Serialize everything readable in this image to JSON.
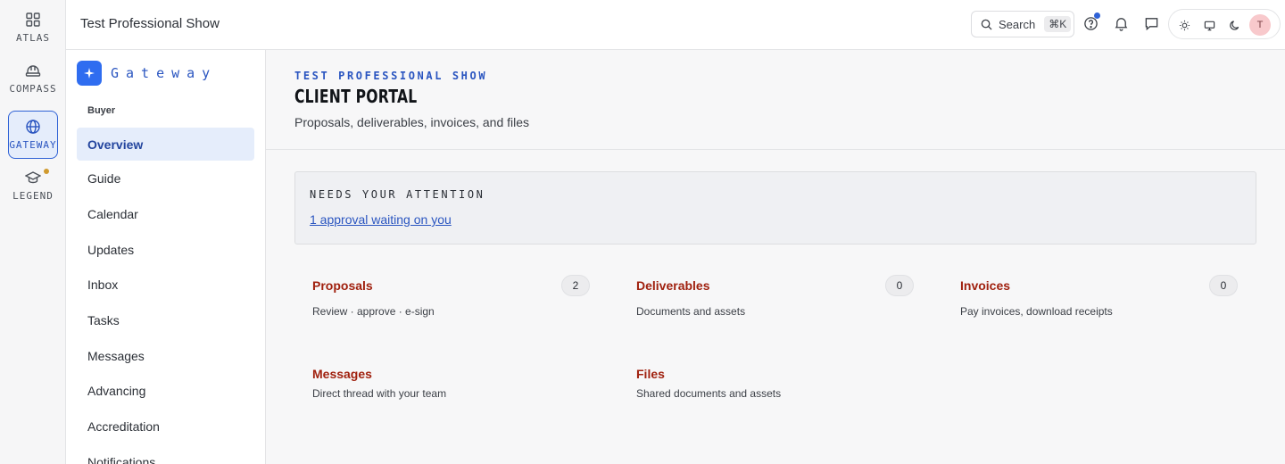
{
  "rail": {
    "items": [
      {
        "label": "ATLAS",
        "icon": "grid-icon"
      },
      {
        "label": "COMPASS",
        "icon": "hard-hat-icon"
      },
      {
        "label": "GATEWAY",
        "icon": "globe-icon",
        "active": true
      },
      {
        "label": "LEGEND",
        "icon": "graduation-cap-icon",
        "has_dot": true
      }
    ]
  },
  "topbar": {
    "title": "Test Professional Show",
    "search_label": "Search",
    "search_shortcut": "⌘K",
    "icons": [
      "help-icon",
      "bell-icon",
      "chat-icon"
    ],
    "theme_options": [
      "sun-icon",
      "monitor-icon",
      "moon-icon"
    ],
    "avatar_initial": "T"
  },
  "sidebar": {
    "brand": "Gateway",
    "section": "Buyer",
    "items": [
      {
        "label": "Overview",
        "active": true
      },
      {
        "label": "Guide"
      },
      {
        "label": "Calendar"
      },
      {
        "label": "Updates"
      },
      {
        "label": "Inbox"
      },
      {
        "label": "Tasks"
      },
      {
        "label": "Messages"
      },
      {
        "label": "Advancing"
      },
      {
        "label": "Accreditation"
      },
      {
        "label": "Notifications"
      }
    ]
  },
  "main": {
    "eyebrow": "TEST PROFESSIONAL SHOW",
    "title": "CLIENT PORTAL",
    "subtitle": "Proposals, deliverables, invoices, and files",
    "attention": {
      "title": "NEEDS YOUR ATTENTION",
      "link": "1 approval waiting on you"
    },
    "cards": [
      {
        "title": "Proposals",
        "desc": "Review · approve · e-sign",
        "count": "2"
      },
      {
        "title": "Deliverables",
        "desc": "Documents and assets",
        "count": "0"
      },
      {
        "title": "Invoices",
        "desc": "Pay invoices, download receipts",
        "count": "0"
      },
      {
        "title": "Messages",
        "desc": "Direct thread with your team"
      },
      {
        "title": "Files",
        "desc": "Shared documents and assets"
      }
    ]
  },
  "colors": {
    "accent": "#2f62d6",
    "card_title": "#a0210f",
    "active_bg": "#e5edfb"
  }
}
